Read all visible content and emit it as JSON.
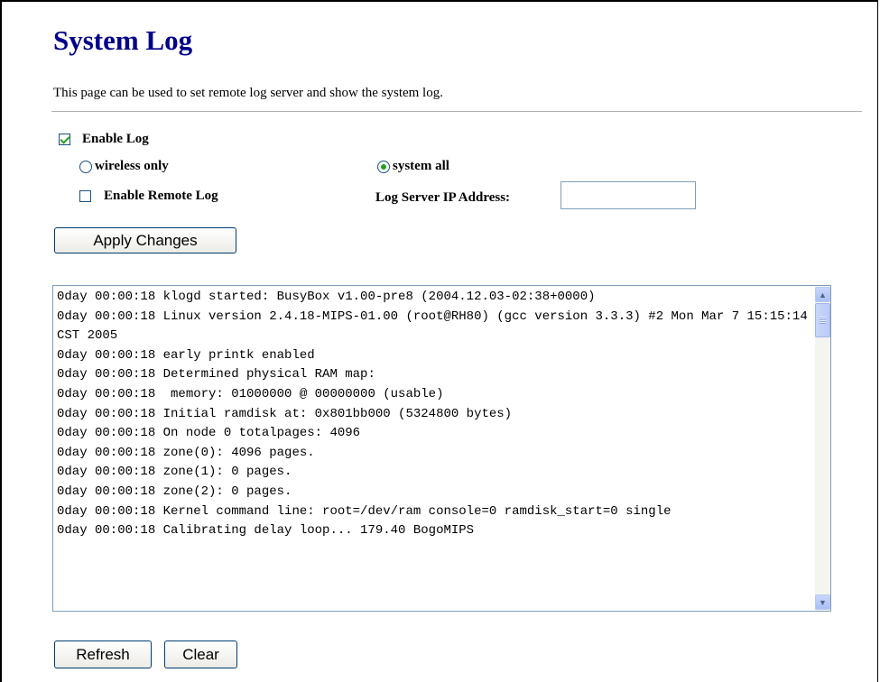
{
  "page": {
    "title": "System Log",
    "description": "This page can be used to set remote log server and show the system log."
  },
  "form": {
    "enable_log": {
      "label": "Enable Log",
      "checked": true
    },
    "wireless_only": {
      "label": "wireless only",
      "checked": false
    },
    "system_all": {
      "label": "system all",
      "checked": true
    },
    "enable_remote_log": {
      "label": "Enable Remote Log",
      "checked": false
    },
    "log_server_ip": {
      "label": "Log Server IP Address:",
      "value": ""
    },
    "apply_label": "Apply Changes"
  },
  "log": {
    "text": "0day 00:00:18 klogd started: BusyBox v1.00-pre8 (2004.12.03-02:38+0000)\n0day 00:00:18 Linux version 2.4.18-MIPS-01.00 (root@RH80) (gcc version 3.3.3) #2 Mon Mar 7 15:15:14 CST 2005\n0day 00:00:18 early printk enabled\n0day 00:00:18 Determined physical RAM map:\n0day 00:00:18  memory: 01000000 @ 00000000 (usable)\n0day 00:00:18 Initial ramdisk at: 0x801bb000 (5324800 bytes)\n0day 00:00:18 On node 0 totalpages: 4096\n0day 00:00:18 zone(0): 4096 pages.\n0day 00:00:18 zone(1): 0 pages.\n0day 00:00:18 zone(2): 0 pages.\n0day 00:00:18 Kernel command line: root=/dev/ram console=0 ramdisk_start=0 single\n0day 00:00:18 Calibrating delay loop... 179.40 BogoMIPS"
  },
  "buttons": {
    "refresh_label": "Refresh",
    "clear_label": "Clear"
  },
  "colors": {
    "title": "#00008b",
    "check_mark": "#21a121",
    "button_border": "#003c74",
    "input_border": "#7f9db9"
  }
}
